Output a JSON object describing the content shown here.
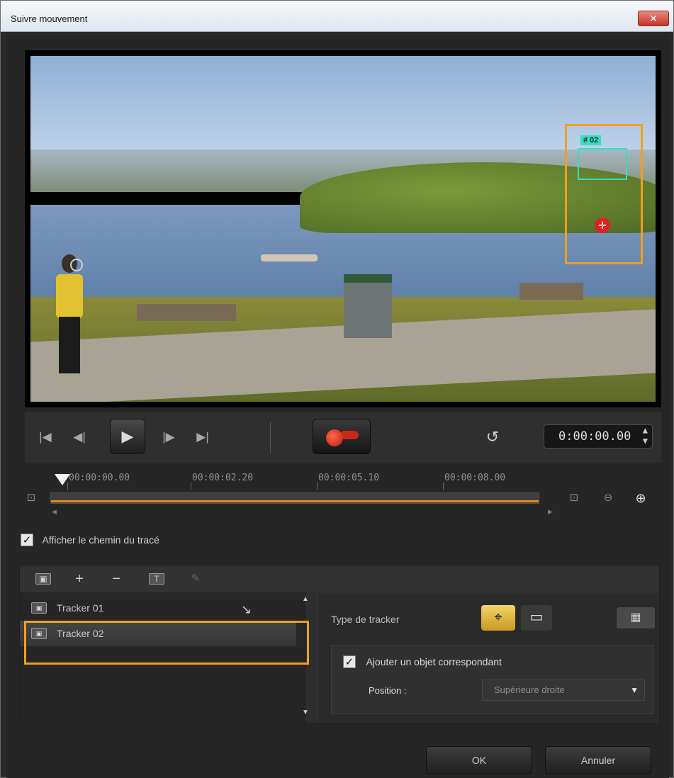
{
  "window": {
    "title": "Suivre mouvement",
    "close_label": "✕"
  },
  "preview": {
    "tracker_label": "# 02"
  },
  "transport": {
    "timecode": "0:00:00.00"
  },
  "timeline": {
    "ticks": [
      "00:00:00.00",
      "00:00:02.20",
      "00:00:05.10",
      "00:00:08.00"
    ]
  },
  "options": {
    "show_path_label": "Afficher le chemin du tracé",
    "show_path_checked": true
  },
  "trackers": {
    "items": [
      {
        "label": "Tracker 01",
        "selected": false
      },
      {
        "label": "Tracker 02",
        "selected": true
      }
    ]
  },
  "settings": {
    "type_label": "Type de tracker",
    "add_object_label": "Ajouter un objet correspondant",
    "add_object_checked": true,
    "position_label": "Position :",
    "position_value": "Supérieure droite"
  },
  "buttons": {
    "ok": "OK",
    "cancel": "Annuler"
  },
  "colors": {
    "highlight": "#f0a020",
    "tracker_box": "#33e0c0",
    "progress": "#e38a1c"
  }
}
